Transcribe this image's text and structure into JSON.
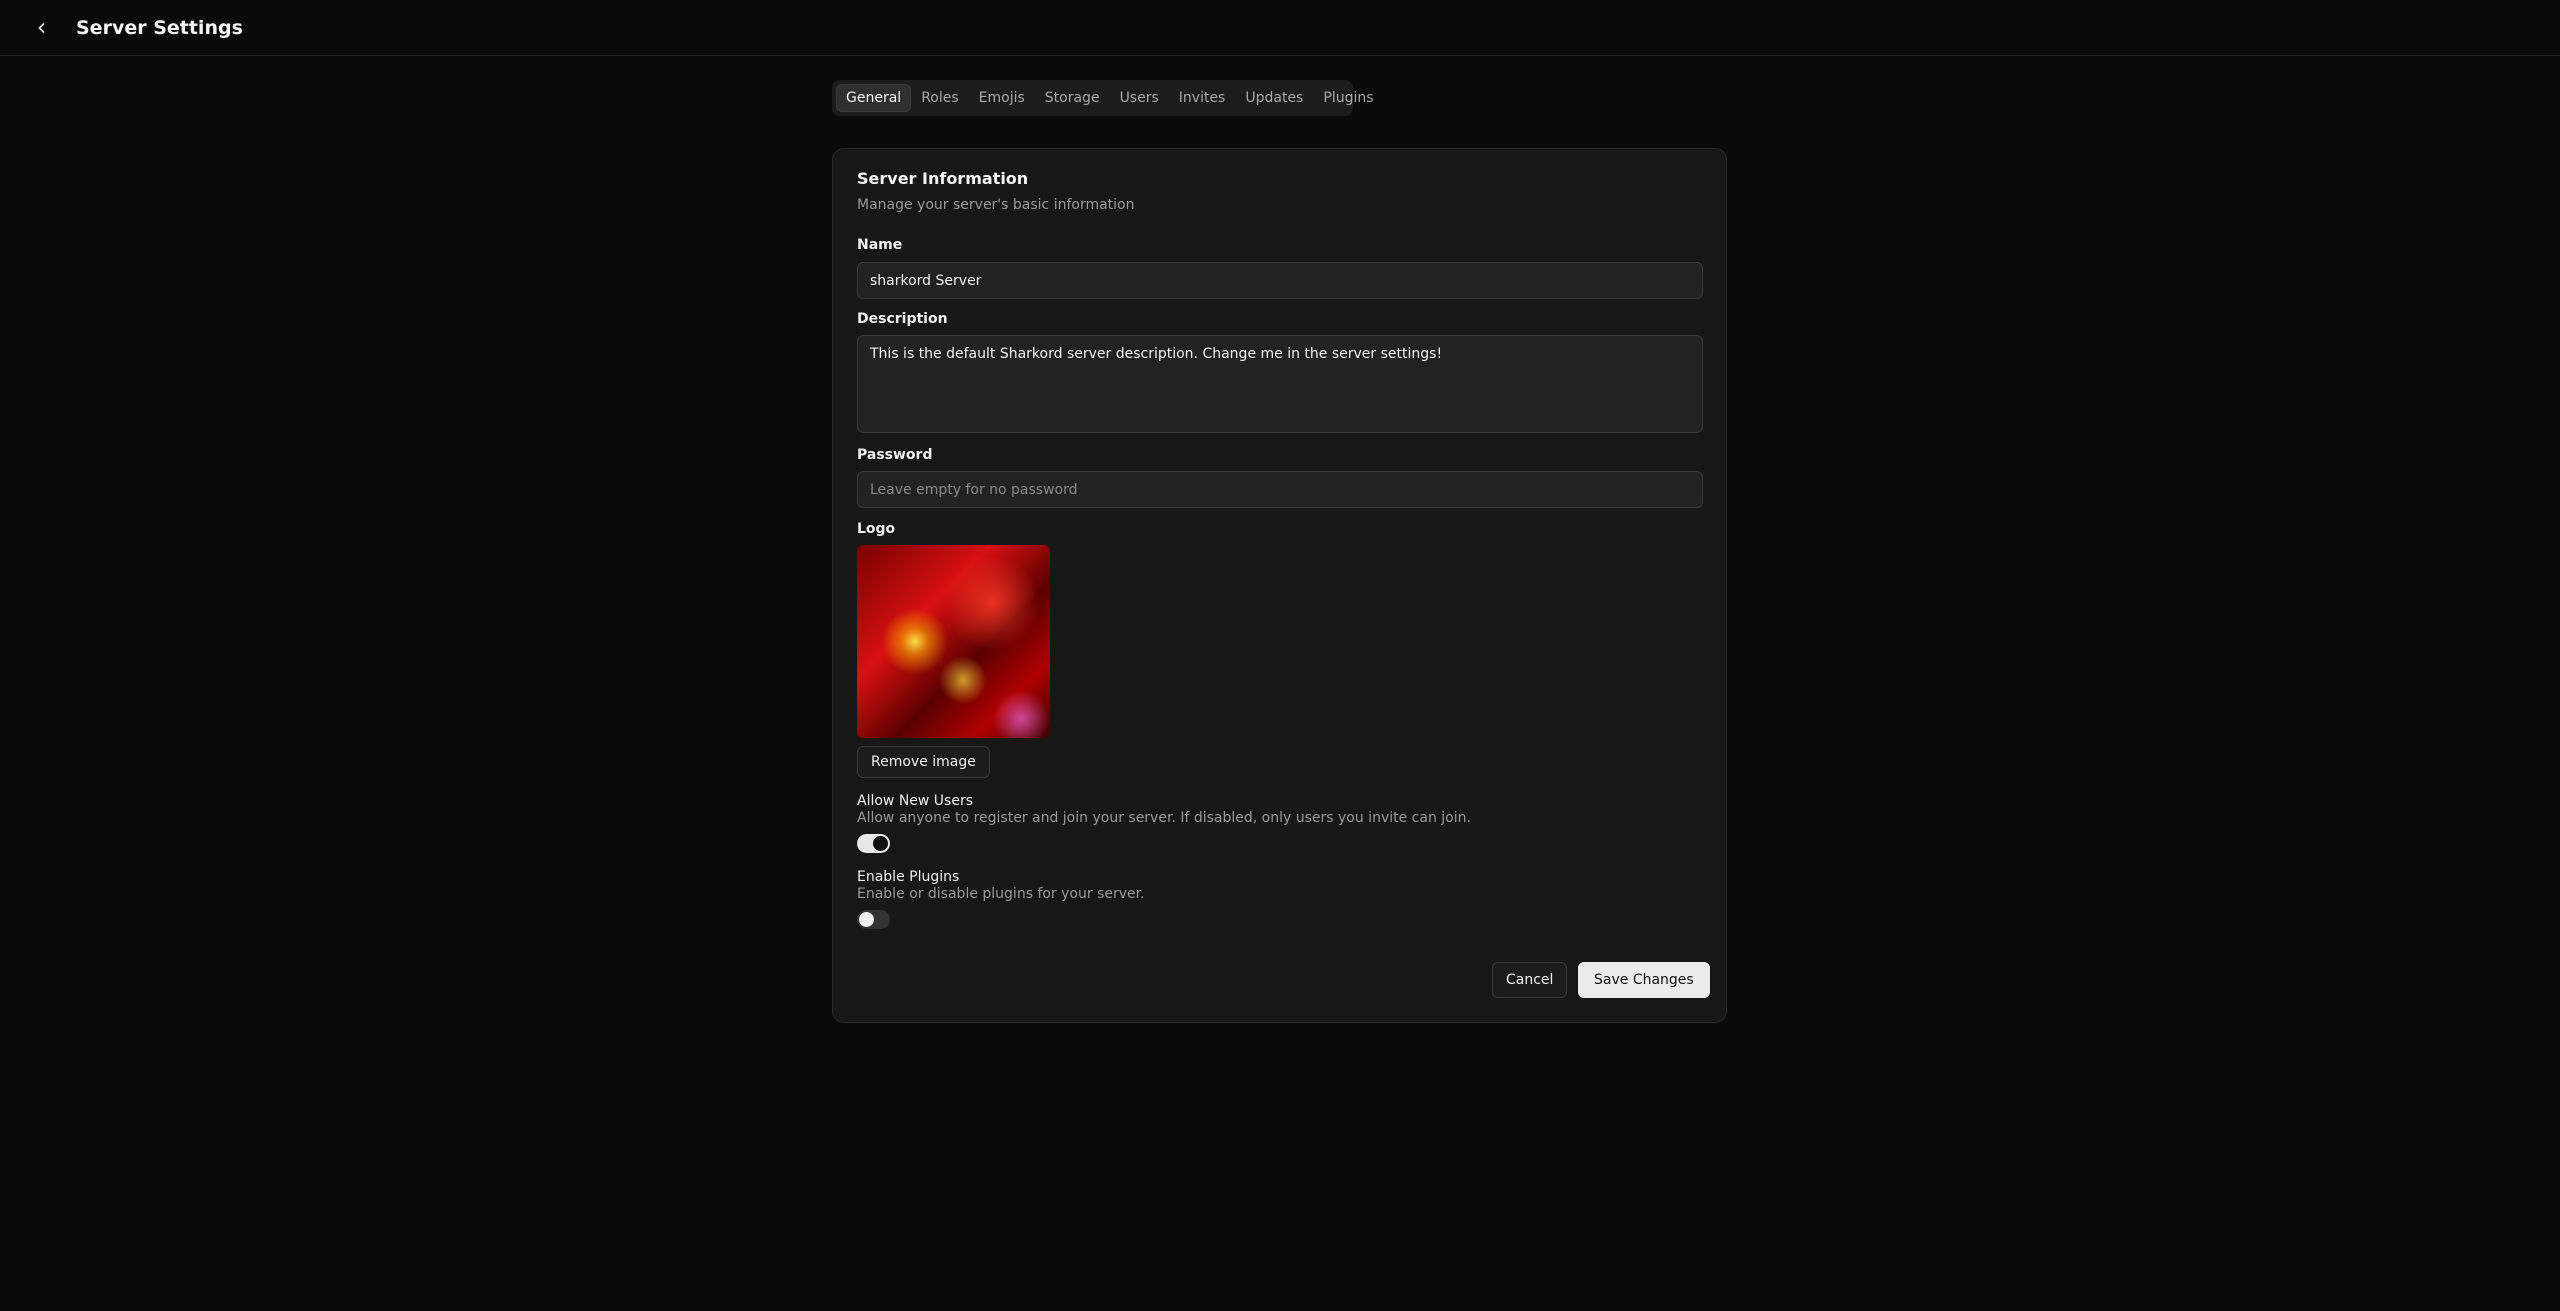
{
  "header": {
    "title": "Server Settings"
  },
  "tabs": [
    {
      "label": "General",
      "active": true
    },
    {
      "label": "Roles"
    },
    {
      "label": "Emojis"
    },
    {
      "label": "Storage"
    },
    {
      "label": "Users"
    },
    {
      "label": "Invites"
    },
    {
      "label": "Updates"
    },
    {
      "label": "Plugins"
    }
  ],
  "card": {
    "title": "Server Information",
    "subtitle": "Manage your server's basic information"
  },
  "form": {
    "name_label": "Name",
    "name_value": "sharkord Server",
    "description_label": "Description",
    "description_value": "This is the default Sharkord server description. Change me in the server settings!",
    "password_label": "Password",
    "password_placeholder": "Leave empty for no password",
    "logo_label": "Logo",
    "remove_image_label": "Remove image"
  },
  "toggles": {
    "allow_new_users": {
      "title": "Allow New Users",
      "description": "Allow anyone to register and join your server. If disabled, only users you invite can join.",
      "enabled": true
    },
    "enable_plugins": {
      "title": "Enable Plugins",
      "description": "Enable or disable plugins for your server.",
      "enabled": false
    }
  },
  "actions": {
    "cancel_label": "Cancel",
    "save_label": "Save Changes"
  },
  "icons": {
    "back": "chevron-left-icon"
  }
}
